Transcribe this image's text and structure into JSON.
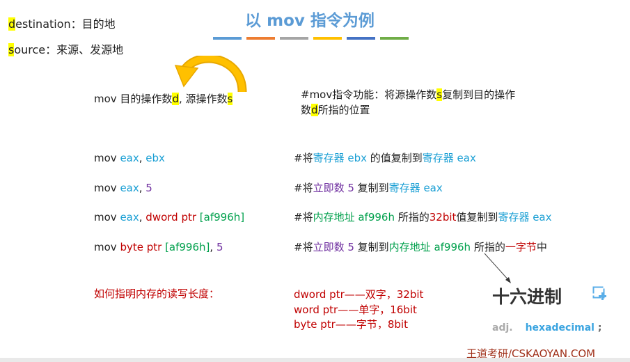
{
  "colors": {
    "blue": "#1a9fd4",
    "purple": "#7030a0",
    "red": "#c00000",
    "green": "#00a04c",
    "title": "#5b9bd5",
    "dark": "#222222",
    "arrow": "#f5b800"
  },
  "title": "以 mov 指令为例",
  "title_bars": [
    "#5b9bd5",
    "#ed7d31",
    "#a5a5a5",
    "#ffc000",
    "#4472c4",
    "#70ad47"
  ],
  "definitions": [
    {
      "letter": "d",
      "rest": "estination：目的地"
    },
    {
      "letter": "s",
      "rest": "ource：来源、发源地"
    }
  ],
  "syntax": {
    "before_d": "mov 目的操作数",
    "d": "d",
    "middle": ", 源操作数",
    "s": "s"
  },
  "function_note": {
    "line1_a": "#mov指令功能：将源操作数",
    "s": "s",
    "line1_b": "复制到目的操作",
    "line2_a": "数",
    "d": "d",
    "line2_b": "所指的位置"
  },
  "examples": [
    {
      "code": [
        [
          "mov ",
          "dark"
        ],
        [
          "eax",
          "blue"
        ],
        [
          ", ",
          "dark"
        ],
        [
          "ebx",
          "blue"
        ]
      ],
      "comment": [
        [
          "#将",
          "dark"
        ],
        [
          "寄存器 ebx",
          "blue"
        ],
        [
          " 的值复制到",
          "dark"
        ],
        [
          "寄存器 eax",
          "blue"
        ]
      ]
    },
    {
      "code": [
        [
          "mov ",
          "dark"
        ],
        [
          "eax",
          "blue"
        ],
        [
          ", ",
          "dark"
        ],
        [
          "5",
          "purple"
        ]
      ],
      "comment": [
        [
          "#将",
          "dark"
        ],
        [
          "立即数 5",
          "purple"
        ],
        [
          " 复制到",
          "dark"
        ],
        [
          "寄存器 eax",
          "blue"
        ]
      ]
    },
    {
      "code": [
        [
          "mov ",
          "dark"
        ],
        [
          "eax",
          "blue"
        ],
        [
          ", ",
          "dark"
        ],
        [
          "dword ptr ",
          "red"
        ],
        [
          "[af996h]",
          "green"
        ]
      ],
      "comment": [
        [
          "#将",
          "dark"
        ],
        [
          "内存地址 af996h",
          "green"
        ],
        [
          " 所指的",
          "dark"
        ],
        [
          "32bit",
          "red"
        ],
        [
          "值复制到",
          "dark"
        ],
        [
          "寄存器 eax",
          "blue"
        ]
      ]
    },
    {
      "code": [
        [
          "mov ",
          "dark"
        ],
        [
          "byte ptr ",
          "red"
        ],
        [
          "[af996h]",
          "green"
        ],
        [
          ", ",
          "dark"
        ],
        [
          "5",
          "purple"
        ]
      ],
      "comment": [
        [
          "#将",
          "dark"
        ],
        [
          "立即数 5",
          "purple"
        ],
        [
          " 复制到",
          "dark"
        ],
        [
          "内存地址 af996h",
          "green"
        ],
        [
          " 所指的",
          "dark"
        ],
        [
          "一字节",
          "red"
        ],
        [
          "中",
          "dark"
        ]
      ]
    }
  ],
  "length_question": "如何指明内存的读写长度：",
  "length_answers": [
    "dword ptr——双字，32bit",
    "word ptr——单字，16bit",
    "byte ptr——字节，8bit"
  ],
  "dictionary": {
    "word": "十六进制",
    "pos": "adj.",
    "translation": "hexadecimal",
    "punct": ";",
    "icon": "add-to-wordbook-icon"
  },
  "watermark": "王道考研/CSKAOYAN.COM"
}
